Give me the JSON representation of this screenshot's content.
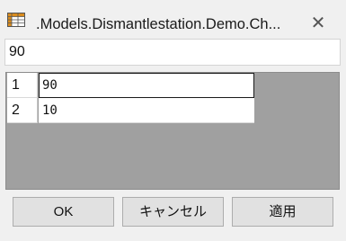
{
  "window": {
    "title": ".Models.Dismantlestation.Demo.Ch...",
    "icons": {
      "app": "table-grid-icon",
      "close": "close-icon"
    },
    "close_glyph": "✕"
  },
  "value_field": {
    "value": "90"
  },
  "grid": {
    "rows": [
      {
        "index": "1",
        "value": "90"
      },
      {
        "index": "2",
        "value": "10"
      }
    ]
  },
  "buttons": {
    "ok": "OK",
    "cancel": "キャンセル",
    "apply": "適用"
  },
  "colors": {
    "grid_background": "#a0a0a0",
    "icon_accent": "#d98c1e"
  }
}
